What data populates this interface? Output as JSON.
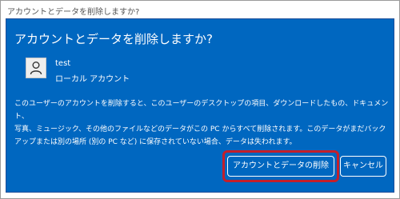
{
  "window": {
    "title": "アカウントとデータを削除しますか?"
  },
  "dialog": {
    "heading": "アカウントとデータを削除しますか?",
    "account": {
      "name": "test",
      "type": "ローカル アカウント",
      "avatar_icon": "user-icon"
    },
    "message": "このユーザーのアカウントを削除すると、このユーザーのデスクトップの項目、ダウンロードしたもの、ドキュメント、\n写真、ミュージック、その他のファイルなどのデータがこの PC からすべて削除されます。このデータがまだバック\nアップまたは別の場所 (別の PC など) に保存されていない場合、データは失われます。",
    "buttons": {
      "delete_label": "アカウントとデータの削除",
      "cancel_label": "キャンセル"
    }
  },
  "colors": {
    "dialog_background": "#0067c0",
    "highlight_border": "#c41f2b",
    "text": "#ffffff"
  }
}
